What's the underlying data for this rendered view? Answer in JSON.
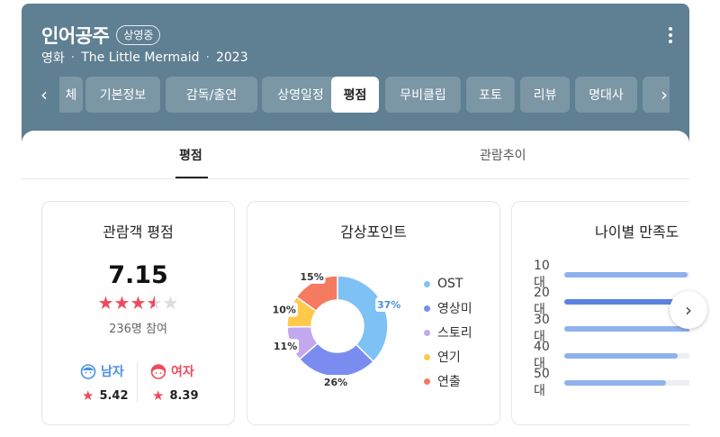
{
  "header": {
    "title": "인어공주",
    "badge": "상영중",
    "meta": [
      "영화",
      "The Little Mermaid",
      "2023"
    ]
  },
  "tabs": {
    "prev_icon": "chevron-left-icon",
    "next_icon": "chevron-right-icon",
    "items": [
      {
        "label": "체",
        "active": false
      },
      {
        "label": "기본정보",
        "active": false
      },
      {
        "label": "감독/출연",
        "active": false
      },
      {
        "label": "상영일정",
        "active": false
      },
      {
        "label": "평점",
        "active": true
      },
      {
        "label": "무비클립",
        "active": false
      },
      {
        "label": "포토",
        "active": false
      },
      {
        "label": "리뷰",
        "active": false
      },
      {
        "label": "명대사",
        "active": false
      }
    ]
  },
  "subtabs": [
    {
      "label": "평점",
      "active": true
    },
    {
      "label": "관람추이",
      "active": false
    }
  ],
  "audience_rating": {
    "title": "관람객 평점",
    "score": "7.15",
    "stars_out_of_5": 3.5,
    "participants": "236명 참여",
    "male": {
      "label": "남자",
      "score": "5.42",
      "color": "#4a90e2"
    },
    "female": {
      "label": "여자",
      "score": "8.39",
      "color": "#ef4a5b"
    }
  },
  "viewing_points": {
    "title": "감상포인트",
    "chart_data": {
      "type": "pie",
      "categories": [
        "OST",
        "영상미",
        "스토리",
        "연기",
        "연출"
      ],
      "values": [
        37,
        26,
        11,
        10,
        15
      ],
      "value_labels": [
        "37%",
        "26%",
        "11%",
        "10%",
        "15%"
      ],
      "colors": [
        "#7ec1f5",
        "#7b8cf0",
        "#c3a8ef",
        "#ffc94d",
        "#f47a60"
      ]
    }
  },
  "age_satisfaction": {
    "title": "나이별 만족도",
    "chart_data": {
      "type": "bar",
      "categories": [
        "10대",
        "20대",
        "30대",
        "40대",
        "50대"
      ],
      "values": [
        0.76,
        0.9,
        0.81,
        0.7,
        0.63
      ]
    }
  },
  "carousel": {
    "next_icon": "chevron-right-icon"
  }
}
